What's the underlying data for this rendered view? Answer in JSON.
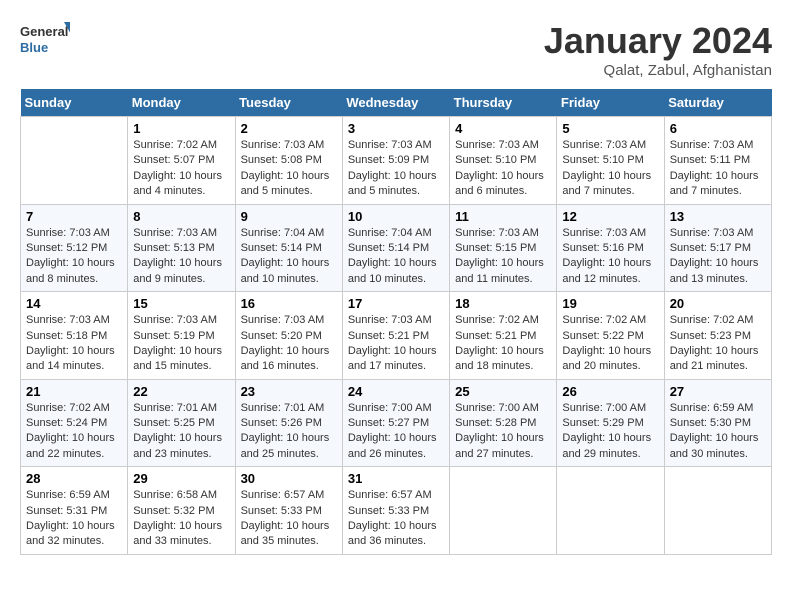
{
  "header": {
    "logo_text_general": "General",
    "logo_text_blue": "Blue",
    "month": "January 2024",
    "location": "Qalat, Zabul, Afghanistan"
  },
  "weekdays": [
    "Sunday",
    "Monday",
    "Tuesday",
    "Wednesday",
    "Thursday",
    "Friday",
    "Saturday"
  ],
  "weeks": [
    [
      {
        "day": "",
        "info": ""
      },
      {
        "day": "1",
        "info": "Sunrise: 7:02 AM\nSunset: 5:07 PM\nDaylight: 10 hours\nand 4 minutes."
      },
      {
        "day": "2",
        "info": "Sunrise: 7:03 AM\nSunset: 5:08 PM\nDaylight: 10 hours\nand 5 minutes."
      },
      {
        "day": "3",
        "info": "Sunrise: 7:03 AM\nSunset: 5:09 PM\nDaylight: 10 hours\nand 5 minutes."
      },
      {
        "day": "4",
        "info": "Sunrise: 7:03 AM\nSunset: 5:10 PM\nDaylight: 10 hours\nand 6 minutes."
      },
      {
        "day": "5",
        "info": "Sunrise: 7:03 AM\nSunset: 5:10 PM\nDaylight: 10 hours\nand 7 minutes."
      },
      {
        "day": "6",
        "info": "Sunrise: 7:03 AM\nSunset: 5:11 PM\nDaylight: 10 hours\nand 7 minutes."
      }
    ],
    [
      {
        "day": "7",
        "info": "Sunrise: 7:03 AM\nSunset: 5:12 PM\nDaylight: 10 hours\nand 8 minutes."
      },
      {
        "day": "8",
        "info": "Sunrise: 7:03 AM\nSunset: 5:13 PM\nDaylight: 10 hours\nand 9 minutes."
      },
      {
        "day": "9",
        "info": "Sunrise: 7:04 AM\nSunset: 5:14 PM\nDaylight: 10 hours\nand 10 minutes."
      },
      {
        "day": "10",
        "info": "Sunrise: 7:04 AM\nSunset: 5:14 PM\nDaylight: 10 hours\nand 10 minutes."
      },
      {
        "day": "11",
        "info": "Sunrise: 7:03 AM\nSunset: 5:15 PM\nDaylight: 10 hours\nand 11 minutes."
      },
      {
        "day": "12",
        "info": "Sunrise: 7:03 AM\nSunset: 5:16 PM\nDaylight: 10 hours\nand 12 minutes."
      },
      {
        "day": "13",
        "info": "Sunrise: 7:03 AM\nSunset: 5:17 PM\nDaylight: 10 hours\nand 13 minutes."
      }
    ],
    [
      {
        "day": "14",
        "info": "Sunrise: 7:03 AM\nSunset: 5:18 PM\nDaylight: 10 hours\nand 14 minutes."
      },
      {
        "day": "15",
        "info": "Sunrise: 7:03 AM\nSunset: 5:19 PM\nDaylight: 10 hours\nand 15 minutes."
      },
      {
        "day": "16",
        "info": "Sunrise: 7:03 AM\nSunset: 5:20 PM\nDaylight: 10 hours\nand 16 minutes."
      },
      {
        "day": "17",
        "info": "Sunrise: 7:03 AM\nSunset: 5:21 PM\nDaylight: 10 hours\nand 17 minutes."
      },
      {
        "day": "18",
        "info": "Sunrise: 7:02 AM\nSunset: 5:21 PM\nDaylight: 10 hours\nand 18 minutes."
      },
      {
        "day": "19",
        "info": "Sunrise: 7:02 AM\nSunset: 5:22 PM\nDaylight: 10 hours\nand 20 minutes."
      },
      {
        "day": "20",
        "info": "Sunrise: 7:02 AM\nSunset: 5:23 PM\nDaylight: 10 hours\nand 21 minutes."
      }
    ],
    [
      {
        "day": "21",
        "info": "Sunrise: 7:02 AM\nSunset: 5:24 PM\nDaylight: 10 hours\nand 22 minutes."
      },
      {
        "day": "22",
        "info": "Sunrise: 7:01 AM\nSunset: 5:25 PM\nDaylight: 10 hours\nand 23 minutes."
      },
      {
        "day": "23",
        "info": "Sunrise: 7:01 AM\nSunset: 5:26 PM\nDaylight: 10 hours\nand 25 minutes."
      },
      {
        "day": "24",
        "info": "Sunrise: 7:00 AM\nSunset: 5:27 PM\nDaylight: 10 hours\nand 26 minutes."
      },
      {
        "day": "25",
        "info": "Sunrise: 7:00 AM\nSunset: 5:28 PM\nDaylight: 10 hours\nand 27 minutes."
      },
      {
        "day": "26",
        "info": "Sunrise: 7:00 AM\nSunset: 5:29 PM\nDaylight: 10 hours\nand 29 minutes."
      },
      {
        "day": "27",
        "info": "Sunrise: 6:59 AM\nSunset: 5:30 PM\nDaylight: 10 hours\nand 30 minutes."
      }
    ],
    [
      {
        "day": "28",
        "info": "Sunrise: 6:59 AM\nSunset: 5:31 PM\nDaylight: 10 hours\nand 32 minutes."
      },
      {
        "day": "29",
        "info": "Sunrise: 6:58 AM\nSunset: 5:32 PM\nDaylight: 10 hours\nand 33 minutes."
      },
      {
        "day": "30",
        "info": "Sunrise: 6:57 AM\nSunset: 5:33 PM\nDaylight: 10 hours\nand 35 minutes."
      },
      {
        "day": "31",
        "info": "Sunrise: 6:57 AM\nSunset: 5:33 PM\nDaylight: 10 hours\nand 36 minutes."
      },
      {
        "day": "",
        "info": ""
      },
      {
        "day": "",
        "info": ""
      },
      {
        "day": "",
        "info": ""
      }
    ]
  ]
}
